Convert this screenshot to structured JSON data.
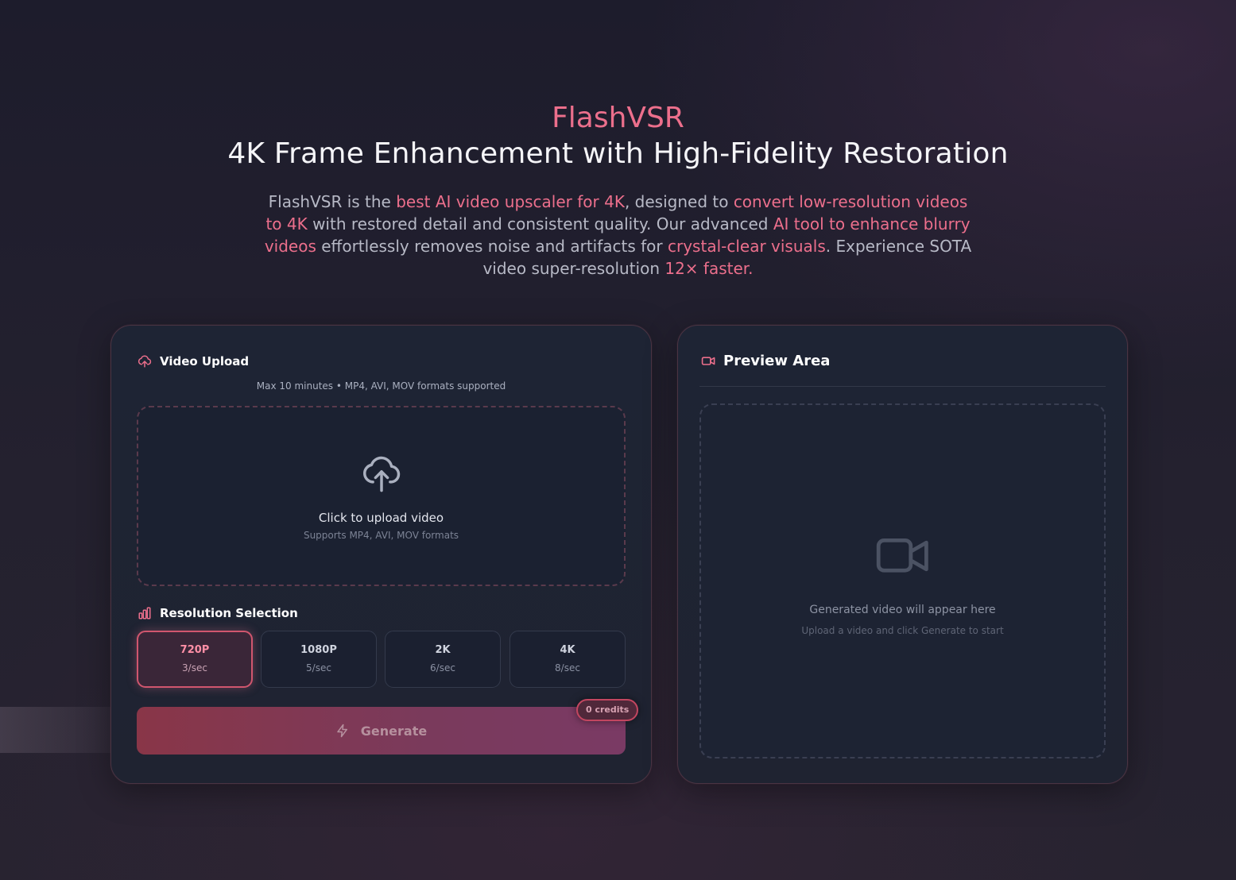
{
  "hero": {
    "brand": "FlashVSR",
    "headline": "4K Frame Enhancement with High-Fidelity Restoration",
    "description": {
      "p1": "FlashVSR is the ",
      "hl1": "best AI video upscaler for 4K",
      "p2": ", designed to ",
      "hl2": "convert low-resolution videos to 4K",
      "p3": " with restored detail and consistent quality. Our advanced ",
      "hl3": "AI tool to enhance blurry videos",
      "p4": " effortlessly removes noise and artifacts for ",
      "hl4": "crystal-clear visuals",
      "p5": ". Experience SOTA video super-resolution ",
      "hl5": "12× faster."
    }
  },
  "upload": {
    "title": "Video Upload",
    "limits": "Max 10 minutes • MP4, AVI, MOV formats supported",
    "dropzone_main": "Click to upload video",
    "dropzone_sub": "Supports MP4, AVI, MOV formats"
  },
  "resolution": {
    "title": "Resolution Selection",
    "options": [
      {
        "label": "720P",
        "rate": "3/sec",
        "selected": true
      },
      {
        "label": "1080P",
        "rate": "5/sec",
        "selected": false
      },
      {
        "label": "2K",
        "rate": "6/sec",
        "selected": false
      },
      {
        "label": "4K",
        "rate": "8/sec",
        "selected": false
      }
    ]
  },
  "generate": {
    "label": "Generate",
    "credits": "0 credits"
  },
  "preview": {
    "title": "Preview Area",
    "empty_main": "Generated video will appear here",
    "empty_sub": "Upload a video and click Generate to start"
  },
  "colors": {
    "accent": "#ec6f8c",
    "background": "#1d1c2c",
    "card": "#1e2434"
  }
}
